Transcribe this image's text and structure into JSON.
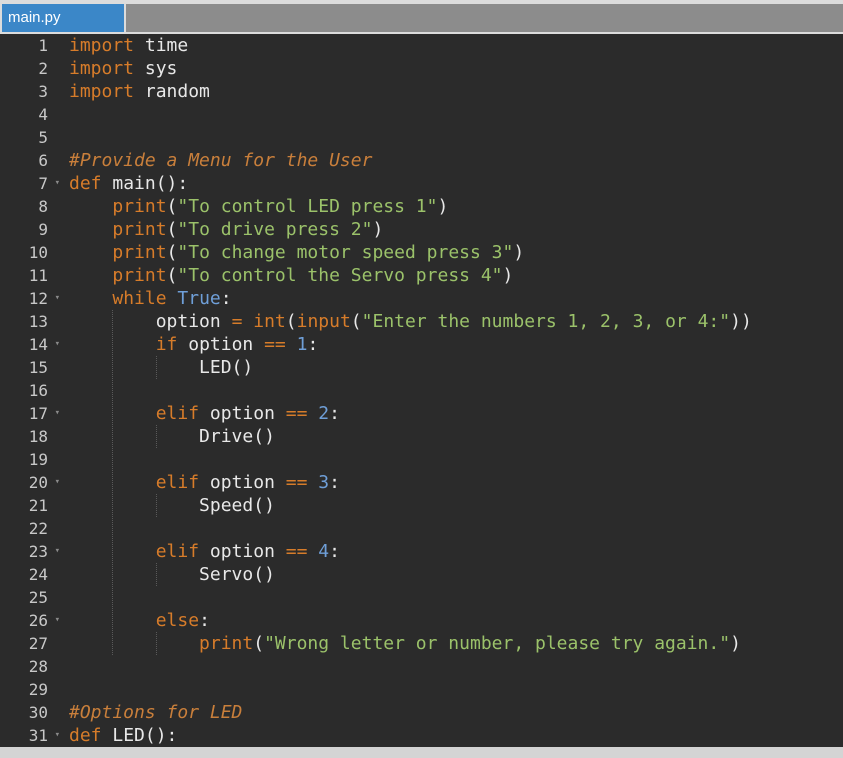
{
  "tab": {
    "label": "main.py"
  },
  "lines": [
    {
      "n": "1",
      "fold": "",
      "tokens": [
        [
          "kw",
          "import"
        ],
        [
          "p",
          " time"
        ]
      ]
    },
    {
      "n": "2",
      "fold": "",
      "tokens": [
        [
          "kw",
          "import"
        ],
        [
          "p",
          " sys"
        ]
      ]
    },
    {
      "n": "3",
      "fold": "",
      "tokens": [
        [
          "kw",
          "import"
        ],
        [
          "p",
          " random"
        ]
      ]
    },
    {
      "n": "4",
      "fold": "",
      "tokens": []
    },
    {
      "n": "5",
      "fold": "",
      "tokens": []
    },
    {
      "n": "6",
      "fold": "",
      "tokens": [
        [
          "cm",
          "#Provide a Menu for the User"
        ]
      ]
    },
    {
      "n": "7",
      "fold": "▾",
      "tokens": [
        [
          "kw",
          "def"
        ],
        [
          "p",
          " main():"
        ]
      ]
    },
    {
      "n": "8",
      "fold": "",
      "tokens": [
        [
          "p",
          "    "
        ],
        [
          "kw",
          "print"
        ],
        [
          "p",
          "("
        ],
        [
          "str",
          "\"To control LED press 1\""
        ],
        [
          "p",
          ")"
        ]
      ]
    },
    {
      "n": "9",
      "fold": "",
      "tokens": [
        [
          "p",
          "    "
        ],
        [
          "kw",
          "print"
        ],
        [
          "p",
          "("
        ],
        [
          "str",
          "\"To drive press 2\""
        ],
        [
          "p",
          ")"
        ]
      ]
    },
    {
      "n": "10",
      "fold": "",
      "tokens": [
        [
          "p",
          "    "
        ],
        [
          "kw",
          "print"
        ],
        [
          "p",
          "("
        ],
        [
          "str",
          "\"To change motor speed press 3\""
        ],
        [
          "p",
          ")"
        ]
      ]
    },
    {
      "n": "11",
      "fold": "",
      "tokens": [
        [
          "p",
          "    "
        ],
        [
          "kw",
          "print"
        ],
        [
          "p",
          "("
        ],
        [
          "str",
          "\"To control the Servo press 4\""
        ],
        [
          "p",
          ")"
        ]
      ]
    },
    {
      "n": "12",
      "fold": "▾",
      "tokens": [
        [
          "p",
          "    "
        ],
        [
          "kw",
          "while"
        ],
        [
          "p",
          " "
        ],
        [
          "const",
          "True"
        ],
        [
          "p",
          ":"
        ]
      ]
    },
    {
      "n": "13",
      "fold": "",
      "tokens": [
        [
          "p",
          "        option "
        ],
        [
          "op",
          "="
        ],
        [
          "p",
          " "
        ],
        [
          "kw",
          "int"
        ],
        [
          "p",
          "("
        ],
        [
          "kw",
          "input"
        ],
        [
          "p",
          "("
        ],
        [
          "str",
          "\"Enter the numbers 1, 2, 3, or 4:\""
        ],
        [
          "p",
          "))"
        ]
      ]
    },
    {
      "n": "14",
      "fold": "▾",
      "tokens": [
        [
          "p",
          "        "
        ],
        [
          "kw",
          "if"
        ],
        [
          "p",
          " option "
        ],
        [
          "op",
          "=="
        ],
        [
          "p",
          " "
        ],
        [
          "num",
          "1"
        ],
        [
          "p",
          ":"
        ]
      ]
    },
    {
      "n": "15",
      "fold": "",
      "tokens": [
        [
          "p",
          "            LED()"
        ]
      ]
    },
    {
      "n": "16",
      "fold": "",
      "tokens": []
    },
    {
      "n": "17",
      "fold": "▾",
      "tokens": [
        [
          "p",
          "        "
        ],
        [
          "kw",
          "elif"
        ],
        [
          "p",
          " option "
        ],
        [
          "op",
          "=="
        ],
        [
          "p",
          " "
        ],
        [
          "num",
          "2"
        ],
        [
          "p",
          ":"
        ]
      ]
    },
    {
      "n": "18",
      "fold": "",
      "tokens": [
        [
          "p",
          "            Drive()"
        ]
      ]
    },
    {
      "n": "19",
      "fold": "",
      "tokens": []
    },
    {
      "n": "20",
      "fold": "▾",
      "tokens": [
        [
          "p",
          "        "
        ],
        [
          "kw",
          "elif"
        ],
        [
          "p",
          " option "
        ],
        [
          "op",
          "=="
        ],
        [
          "p",
          " "
        ],
        [
          "num",
          "3"
        ],
        [
          "p",
          ":"
        ]
      ]
    },
    {
      "n": "21",
      "fold": "",
      "tokens": [
        [
          "p",
          "            Speed()"
        ]
      ]
    },
    {
      "n": "22",
      "fold": "",
      "tokens": []
    },
    {
      "n": "23",
      "fold": "▾",
      "tokens": [
        [
          "p",
          "        "
        ],
        [
          "kw",
          "elif"
        ],
        [
          "p",
          " option "
        ],
        [
          "op",
          "=="
        ],
        [
          "p",
          " "
        ],
        [
          "num",
          "4"
        ],
        [
          "p",
          ":"
        ]
      ]
    },
    {
      "n": "24",
      "fold": "",
      "tokens": [
        [
          "p",
          "            Servo()"
        ]
      ]
    },
    {
      "n": "25",
      "fold": "",
      "tokens": []
    },
    {
      "n": "26",
      "fold": "▾",
      "tokens": [
        [
          "p",
          "        "
        ],
        [
          "kw",
          "else"
        ],
        [
          "p",
          ":"
        ]
      ]
    },
    {
      "n": "27",
      "fold": "",
      "tokens": [
        [
          "p",
          "            "
        ],
        [
          "kw",
          "print"
        ],
        [
          "p",
          "("
        ],
        [
          "str",
          "\"Wrong letter or number, please try again.\""
        ],
        [
          "p",
          ")"
        ]
      ]
    },
    {
      "n": "28",
      "fold": "",
      "tokens": []
    },
    {
      "n": "29",
      "fold": "",
      "tokens": []
    },
    {
      "n": "30",
      "fold": "",
      "tokens": [
        [
          "cm",
          "#Options for LED"
        ]
      ]
    },
    {
      "n": "31",
      "fold": "▾",
      "tokens": [
        [
          "kw",
          "def"
        ],
        [
          "p",
          " LED():"
        ]
      ]
    }
  ]
}
